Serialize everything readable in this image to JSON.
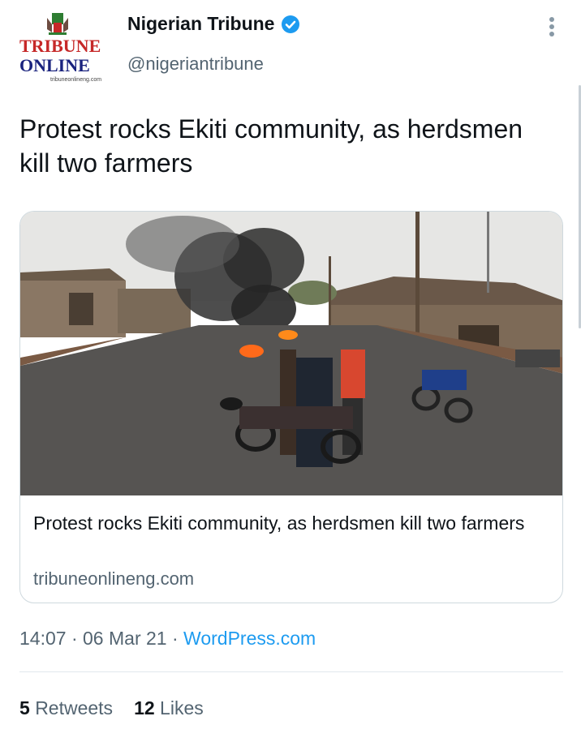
{
  "author": {
    "name": "Nigerian Tribune",
    "handle": "@nigeriantribune",
    "verified": true,
    "logo_text_line1": "TRIBUNE",
    "logo_text_line2": "ONLINE",
    "logo_subtext": "tribuneonlineng.com"
  },
  "tweet": {
    "text": "Protest rocks Ekiti community, as herdsmen kill two farmers"
  },
  "link_card": {
    "image_alt": "Protesters burning tyres on a road with motorcycles",
    "title": "Protest rocks Ekiti community, as herdsmen kill two farmers",
    "domain": "tribuneonlineng.com"
  },
  "meta": {
    "time": "14:07",
    "date": "06 Mar 21",
    "separator": " · ",
    "source": "WordPress.com"
  },
  "stats": {
    "retweets_count": "5",
    "retweets_label": "Retweets",
    "likes_count": "12",
    "likes_label": "Likes"
  },
  "colors": {
    "accent": "#1d9bf0",
    "text": "#0f1419",
    "secondary": "#536471",
    "border": "#cfd9de"
  }
}
